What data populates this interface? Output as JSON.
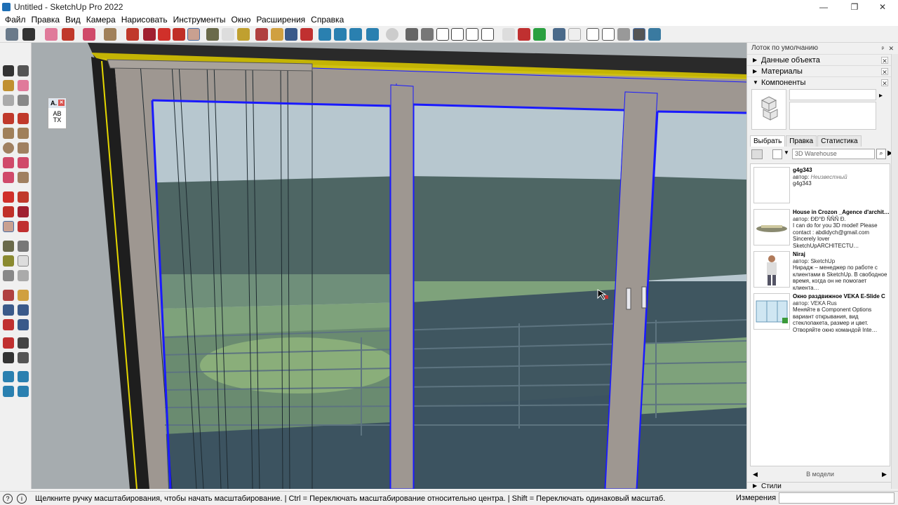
{
  "window": {
    "title": "Untitled - SketchUp Pro 2022",
    "minimize": "—",
    "maximize": "❐",
    "close": "✕"
  },
  "menu": [
    "Файл",
    "Правка",
    "Вид",
    "Камера",
    "Нарисовать",
    "Инструменты",
    "Окно",
    "Расширения",
    "Справка"
  ],
  "tag_widget": {
    "label": "A.",
    "close": "✕",
    "text_top": "AB",
    "text_bottom": "TX"
  },
  "tray": {
    "title": "Лоток по умолчанию",
    "panels": [
      {
        "label": "Данные объекта",
        "arrow": "▶"
      },
      {
        "label": "Материалы",
        "arrow": "▶"
      },
      {
        "label": "Компоненты",
        "arrow": "▼"
      }
    ],
    "tabs": [
      "Выбрать",
      "Правка",
      "Статистика"
    ],
    "search_placeholder": "3D Warehouse",
    "results": [
      {
        "name": "g4g343",
        "author_label": "автор:",
        "author": "Неизвестный",
        "desc": "g4g343",
        "unknown": true
      },
      {
        "name": "House in Crozon _Agence d'archit…",
        "author_label": "автор:",
        "author": "ÐÐ°Ð ÑÑÑ Ð.",
        "desc": "I can do for you 3D model! Please contact : abdidych@gmail.com Sincerely lover SketchUpARCHITECTU…",
        "unknown": false
      },
      {
        "name": "Niraj",
        "author_label": "автор:",
        "author": "SketchUp",
        "desc": "Нирадж – менеджер по работе с клиентами в SketchUp. В свободное время, когда он не помогает клиента…",
        "unknown": false
      },
      {
        "name": "Окно раздвижное VEKA E-Slide C",
        "author_label": "автор:",
        "author": "VEKA Rus",
        "desc": "Меняйте в Component Options вариант открывания, вид стеклопакета, размер и цвет. Отворяйте окно командой Inte…",
        "unknown": false
      }
    ],
    "in_model": "В модели",
    "styles": "Стили"
  },
  "status": {
    "hint": "Щелкните ручку масштабирования, чтобы начать масштабирование. | Ctrl = Переключать масштабирование относительно центра. | Shift = Переключать одинаковый масштаб.",
    "measure_label": "Измерения",
    "measure_value": ""
  },
  "colors": {
    "accent_blue": "#1a1aff",
    "frame_gray": "#9e9791",
    "sky": "#b7c7cf",
    "trees": "#4e6664",
    "lawn": "#7ea27b",
    "deck": "#3c5360"
  }
}
